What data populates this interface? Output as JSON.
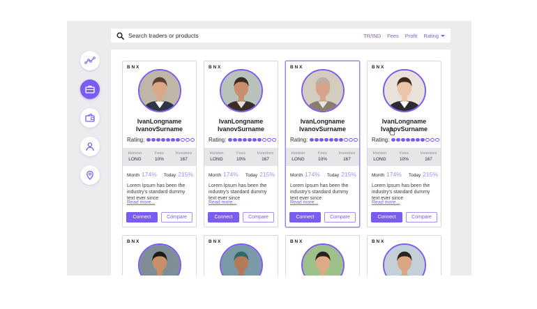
{
  "search": {
    "placeholder": "Search traders or products"
  },
  "filters": {
    "tr_ind": "TR/IND",
    "fees": "Fees",
    "profit": "Profit",
    "rating": "Rating"
  },
  "sidebar": {
    "items": [
      {
        "icon": "line-chart-icon",
        "active": false
      },
      {
        "icon": "briefcase-icon",
        "active": true
      },
      {
        "icon": "wallet-icon",
        "active": false
      },
      {
        "icon": "user-icon",
        "active": false
      },
      {
        "icon": "location-pin-icon",
        "active": false
      }
    ]
  },
  "labels": {
    "rating": "Rating:",
    "horizon": "Horizon",
    "fees": "Fees",
    "investors": "Investors",
    "month": "Month",
    "today": "Today",
    "read_more": "Read more...",
    "connect": "Connect",
    "compare": "Compare"
  },
  "traders": [
    {
      "brand": "BNX",
      "first": "IvanLongname",
      "last": "IvanovSurname",
      "rating": 7,
      "rating_max": 10,
      "horizon": "LONG",
      "fees": "10%",
      "investors": "167",
      "month": "174%",
      "today": "215%",
      "desc": "Lorem Ipsum has been the industry's standard dummy text ever since",
      "selected": false
    },
    {
      "brand": "BNX",
      "first": "IvanLongname",
      "last": "IvanovSurname",
      "rating": 7,
      "rating_max": 10,
      "horizon": "LONG",
      "fees": "10%",
      "investors": "167",
      "month": "174%",
      "today": "215%",
      "desc": "Lorem Ipsum has been the industry's standard dummy text ever since",
      "selected": false
    },
    {
      "brand": "BNX",
      "first": "IvanLongname",
      "last": "IvanovSurname",
      "rating": 7,
      "rating_max": 10,
      "horizon": "LONG",
      "fees": "10%",
      "investors": "167",
      "month": "174%",
      "today": "215%",
      "desc": "Lorem Ipsum has been the industry's standard dummy text ever since",
      "selected": true
    },
    {
      "brand": "BNX",
      "first": "IvanLongname",
      "last": "IvanovSurname",
      "rating": 7,
      "rating_max": 10,
      "horizon": "LONG",
      "fees": "10%",
      "investors": "167",
      "month": "174%",
      "today": "215%",
      "desc": "Lorem Ipsum has been the industry's standard dummy text ever since",
      "selected": false
    }
  ],
  "traders_row2": [
    {
      "brand": "BNX"
    },
    {
      "brand": "BNX"
    },
    {
      "brand": "BNX"
    },
    {
      "brand": "BNX"
    }
  ],
  "colors": {
    "accent": "#7b5cf0",
    "accent_light": "#a68ff5",
    "panel_bg": "#ececef",
    "stats_bg": "#e6e6e9"
  }
}
